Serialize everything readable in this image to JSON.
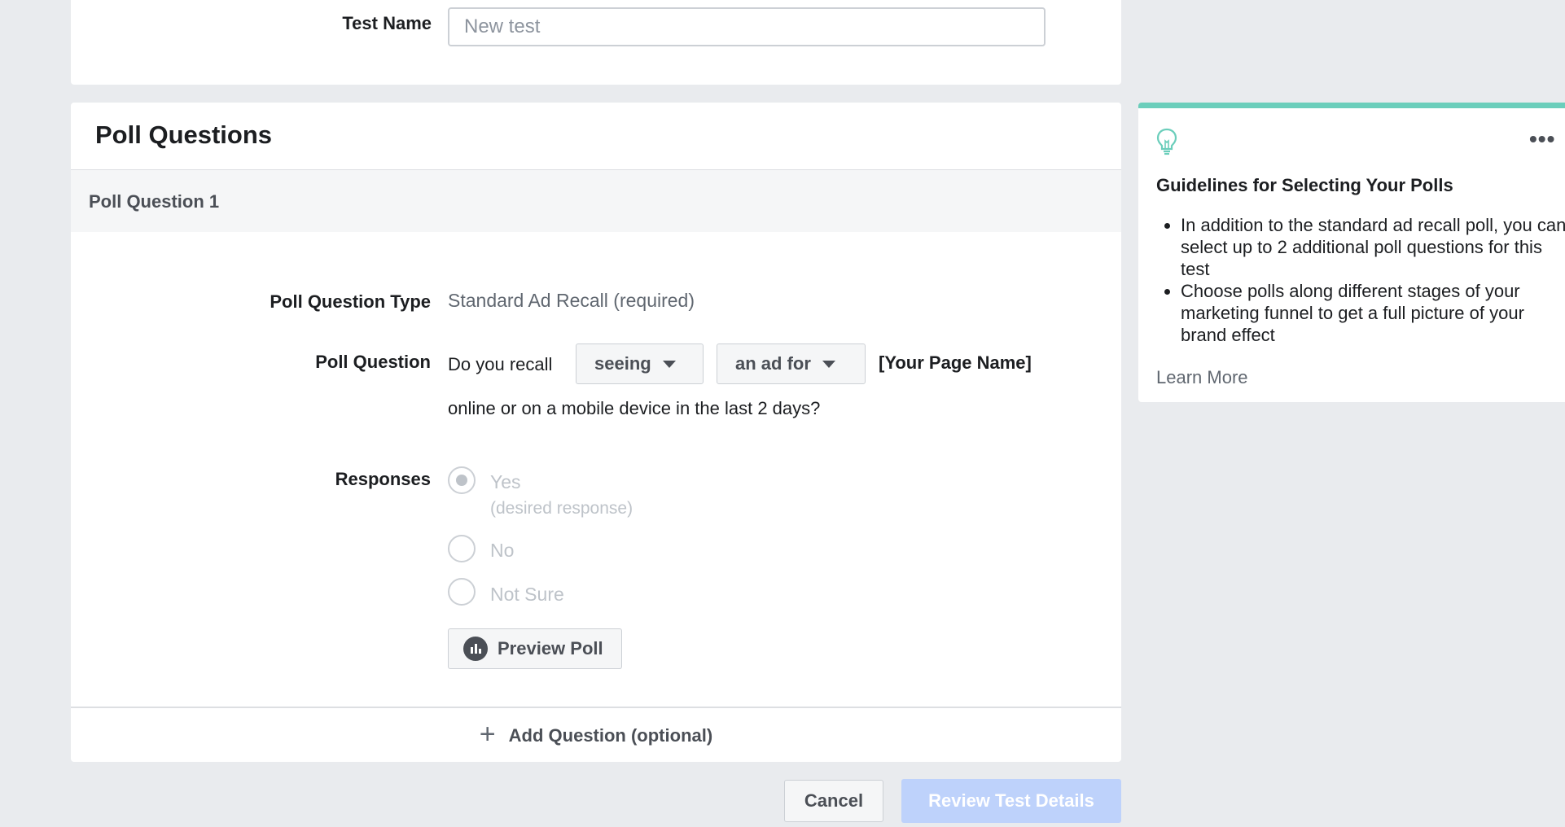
{
  "test_name": {
    "label": "Test Name",
    "placeholder": "New test"
  },
  "poll_questions": {
    "title": "Poll Questions",
    "question_header": "Poll Question 1",
    "type_label": "Poll Question Type",
    "type_value": "Standard Ad Recall (required)",
    "question_label": "Poll Question",
    "question_prefix": "Do you recall",
    "dropdown1": "seeing",
    "dropdown2": "an ad for",
    "page_name": "[Your Page Name]",
    "question_suffix": "online or on a mobile device in the last 2 days?",
    "responses_label": "Responses",
    "responses": [
      {
        "label": "Yes",
        "sub": "(desired response)",
        "selected": true
      },
      {
        "label": "No",
        "sub": "",
        "selected": false
      },
      {
        "label": "Not Sure",
        "sub": "",
        "selected": false
      }
    ],
    "preview_button": "Preview Poll",
    "add_question": "Add Question (optional)"
  },
  "footer": {
    "cancel": "Cancel",
    "review": "Review Test Details"
  },
  "tips": {
    "title": "Guidelines for Selecting Your Polls",
    "bullets": [
      "In addition to the standard ad recall poll, you can select up to 2 additional poll questions for this test",
      "Choose polls along different stages of your marketing funnel to get a full picture of your brand effect"
    ],
    "learn_more": "Learn More",
    "more_icon": "ellipsis-icon",
    "tip_icon": "lightbulb-icon"
  },
  "colors": {
    "page_bg": "#e9ebee",
    "accent_bar": "#6bcebb",
    "review_disabled": "#bed2fb"
  }
}
